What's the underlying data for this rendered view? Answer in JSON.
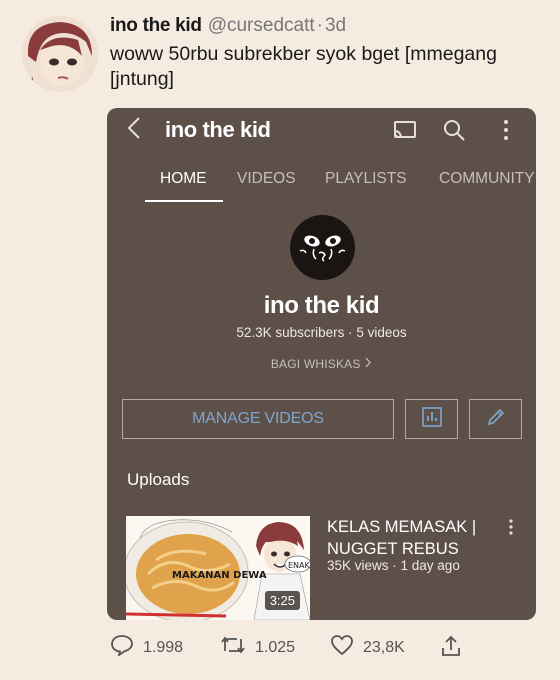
{
  "tweet": {
    "name": "ino the kid",
    "handle": "@cursedcatt",
    "separator": "·",
    "time": "3d",
    "text": "woww 50rbu subrekber syok bget [mmegang [jntung]"
  },
  "app": {
    "back_icon": "chevron-left-icon",
    "channel_title": "ino the kid",
    "icons": [
      "cast-icon",
      "search-icon",
      "more-vertical-icon"
    ],
    "tabs": [
      {
        "label": "HOME",
        "active": true
      },
      {
        "label": "VIDEOS",
        "active": false
      },
      {
        "label": "PLAYLISTS",
        "active": false
      },
      {
        "label": "COMMUNITY",
        "active": false
      }
    ],
    "channel": {
      "name": "ino the kid",
      "stats": "52.3K subscribers · 5 videos",
      "link": "BAGI WHISKAS"
    },
    "buttons": {
      "manage": "MANAGE VIDEOS",
      "analytics_icon": "analytics-icon",
      "edit_icon": "pencil-icon"
    },
    "uploads_heading": "Uploads",
    "video": {
      "title": "KELAS MEMASAK | NUGGET REBUS",
      "meta": "35K views · 1 day ago",
      "duration": "3:25",
      "thumb_caption": "MAKANAN DEWA",
      "thumb_bubble": "ENAK"
    }
  },
  "actions": {
    "replies": "1.998",
    "retweets": "1.025",
    "likes": "23,8K"
  },
  "colors": {
    "page_bg": "#f5ebe0",
    "phone_bg": "#5c5048",
    "accent_blue": "#7fa6cf"
  }
}
